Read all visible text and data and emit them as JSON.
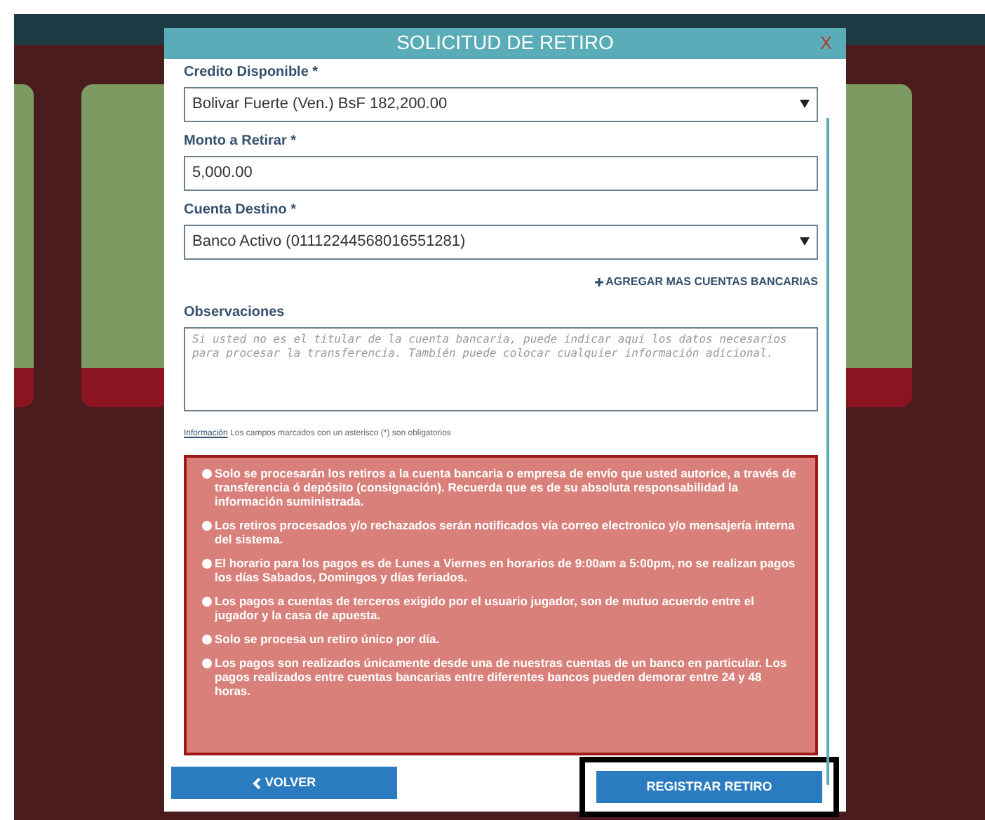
{
  "dialog": {
    "title": "SOLICITUD DE RETIRO",
    "close": "X"
  },
  "fields": [
    {
      "kind": "select",
      "label": "Credito Disponible *",
      "value": "Bolivar Fuerte (Ven.) BsF 182,200.00"
    },
    {
      "kind": "input",
      "label": "Monto a Retirar *",
      "value": "5,000.00"
    },
    {
      "kind": "select",
      "label": "Cuenta Destino *",
      "value": "Banco Activo (01112244568016551281)"
    },
    {
      "kind": "link",
      "label": "AGREGAR MAS CUENTAS BANCARIAS"
    },
    {
      "kind": "textarea",
      "label": "Observaciones",
      "placeholder": "Si usted no es el titular de la cuenta bancaria, puede indicar aquí los datos necesarios para procesar la transferencia. También puede colocar cualquier información adicional."
    }
  ],
  "info": {
    "link": "Información",
    "text": "Los campos marcados con un asterisco (*) son obligatorios"
  },
  "notices": [
    "Solo se procesarán los retiros a la cuenta bancaria o empresa de envío que usted autorice, a través de transferencia ó depósito (consignación). Recuerda que es de su absoluta responsabilidad la información suministrada.",
    "Los retiros procesados y/o rechazados serán notificados vía correo electronico y/o mensajería interna del sistema.",
    "El horario para los pagos es de Lunes a Viernes en horarios de 9:00am a 5:00pm, no se realizan pagos los días Sabados, Domingos y días feriados.",
    "Los pagos a cuentas de terceros exigido por el usuario jugador, son de mutuo acuerdo entre el jugador y la casa de apuesta.",
    "Solo se procesa un retiro único por día.",
    "Los pagos son realizados únicamente desde una de nuestras cuentas de un banco en particular. Los pagos realizados entre cuentas bancarias entre diferentes bancos pueden demorar entre 24 y 48 horas."
  ],
  "buttons": [
    {
      "kind": "back",
      "label": "VOLVER",
      "highlighted": false
    },
    {
      "kind": "submit",
      "label": "REGISTRAR RETIRO",
      "highlighted": true
    }
  ]
}
